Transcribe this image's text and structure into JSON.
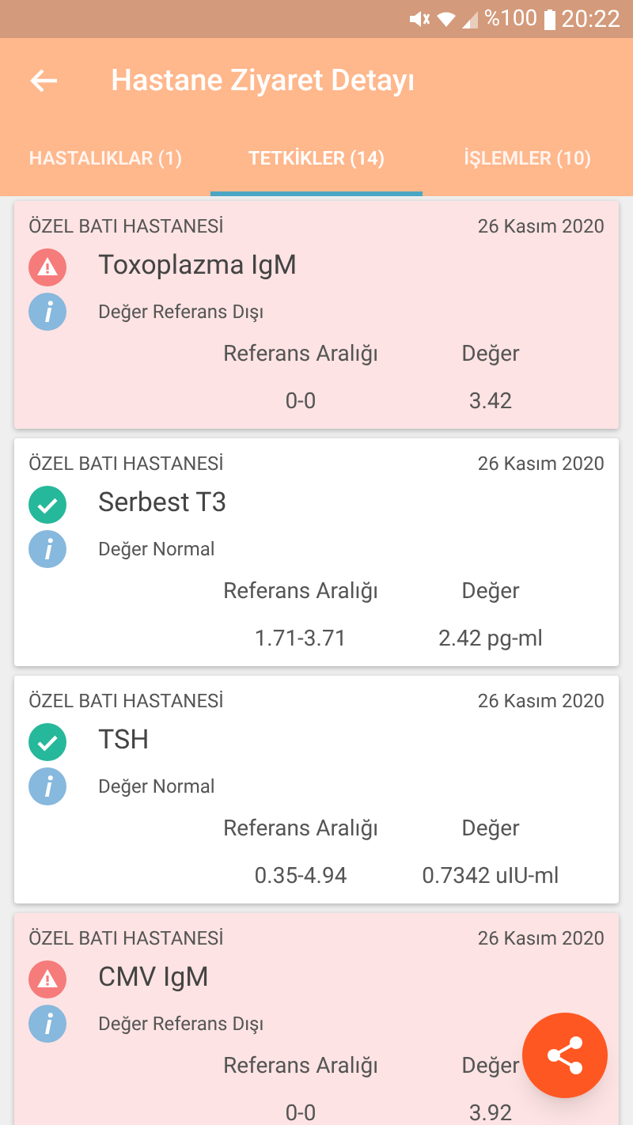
{
  "status_bar": {
    "battery": "%100",
    "time": "20:22"
  },
  "app_bar": {
    "title": "Hastane Ziyaret Detayı"
  },
  "tabs": [
    {
      "label": "HASTALIKLAR (1)",
      "selected": false
    },
    {
      "label": "TETKİKLER (14)",
      "selected": true
    },
    {
      "label": "İŞLEMLER (10)",
      "selected": false
    }
  ],
  "tests": [
    {
      "hospital": "ÖZEL BATI HASTANESİ",
      "date": "26 Kasım 2020",
      "name": "Toxoplazma IgM",
      "kind": "abnormal",
      "note": "Değer Referans Dışı",
      "range_label": "Referans Aralığı",
      "value_label": "Değer",
      "range": "0-0",
      "value": "3.42"
    },
    {
      "hospital": "ÖZEL BATI HASTANESİ",
      "date": "26 Kasım 2020",
      "name": "Serbest T3",
      "kind": "normal",
      "note": "Değer Normal",
      "range_label": "Referans Aralığı",
      "value_label": "Değer",
      "range": "1.71-3.71",
      "value": "2.42 pg-ml"
    },
    {
      "hospital": "ÖZEL BATI HASTANESİ",
      "date": "26 Kasım 2020",
      "name": "TSH",
      "kind": "normal",
      "note": "Değer Normal",
      "range_label": "Referans Aralığı",
      "value_label": "Değer",
      "range": "0.35-4.94",
      "value": "0.7342 uIU-ml"
    },
    {
      "hospital": "ÖZEL BATI HASTANESİ",
      "date": "26 Kasım 2020",
      "name": "CMV IgM",
      "kind": "abnormal",
      "note": "Değer Referans Dışı",
      "range_label": "Referans Aralığı",
      "value_label": "Değer",
      "range": "0-0",
      "value": "3.92"
    }
  ]
}
